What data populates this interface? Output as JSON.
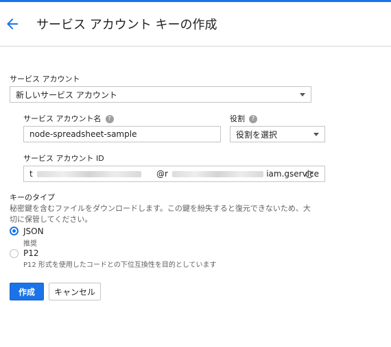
{
  "header": {
    "title": "サービス アカウント キーの作成"
  },
  "service_account": {
    "label": "サービス アカウント",
    "selected": "新しいサービス アカウント",
    "name_label": "サービス アカウント名",
    "name_value": "node-spreadsheet-sample",
    "role_label": "役割",
    "role_selected": "役割を選択",
    "id_label": "サービス アカウント ID",
    "id_prefix": "t",
    "id_at": "@r",
    "id_suffix": "iam.gservice"
  },
  "key_type": {
    "label": "キーのタイプ",
    "description_line1": "秘密鍵を含むファイルをダウンロードします。この鍵を紛失すると復元できないため、大",
    "description_line2": "切に保管してください。",
    "options": [
      {
        "label": "JSON",
        "sub": "推奨",
        "selected": true
      },
      {
        "label": "P12",
        "sub": "P12 形式を使用したコードとの下位互換性を目的としています",
        "selected": false
      }
    ]
  },
  "actions": {
    "create_label": "作成",
    "cancel_label": "キャンセル"
  },
  "colors": {
    "accent": "#1a73e8"
  },
  "icons": {
    "back": "arrow-left-icon",
    "help": "help-circle-icon",
    "refresh": "refresh-icon"
  }
}
